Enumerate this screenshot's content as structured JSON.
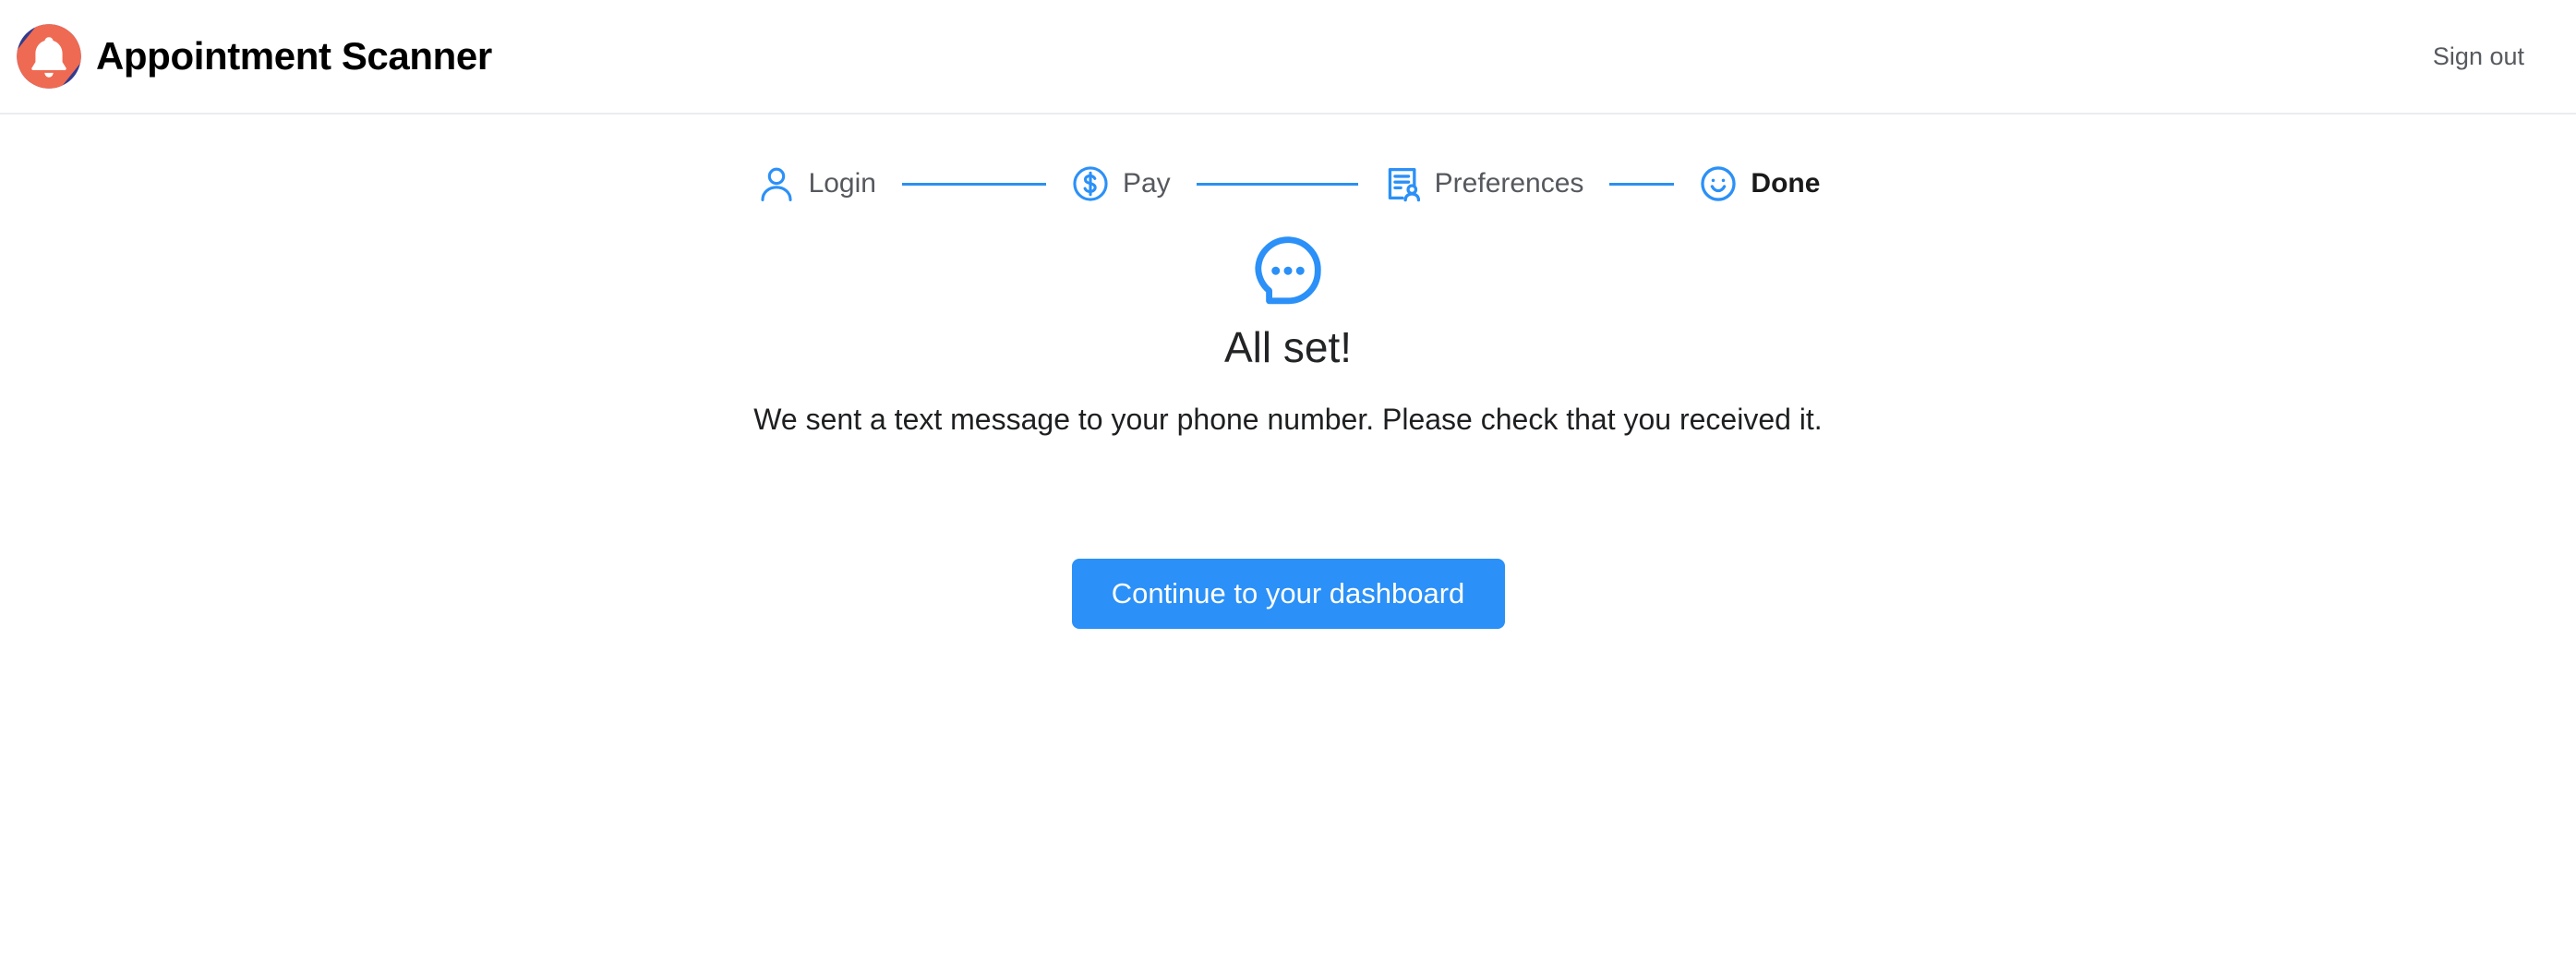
{
  "header": {
    "brand_name": "Appointment Scanner",
    "logo_icon": "bell-logo-icon",
    "signout_label": "Sign out"
  },
  "stepper": {
    "steps": [
      {
        "label": "Login",
        "icon": "person-icon",
        "state": "complete"
      },
      {
        "label": "Pay",
        "icon": "dollar-circle-icon",
        "state": "complete"
      },
      {
        "label": "Preferences",
        "icon": "document-person-icon",
        "state": "complete"
      },
      {
        "label": "Done",
        "icon": "smiley-circle-icon",
        "state": "active"
      }
    ]
  },
  "main": {
    "status_icon": "chat-bubble-dots-icon",
    "headline": "All set!",
    "message": "We sent a text message to your phone number. Please check that you received it."
  },
  "cta": {
    "label": "Continue to your dashboard"
  },
  "colors": {
    "accent_blue": "#2b90f7",
    "step_line_blue": "#2b90f0",
    "logo_navy": "#313b8e",
    "logo_coral": "#ef6a52",
    "header_border": "#ebecef",
    "muted_text": "#55585d",
    "active_text": "#1a1a1a"
  }
}
